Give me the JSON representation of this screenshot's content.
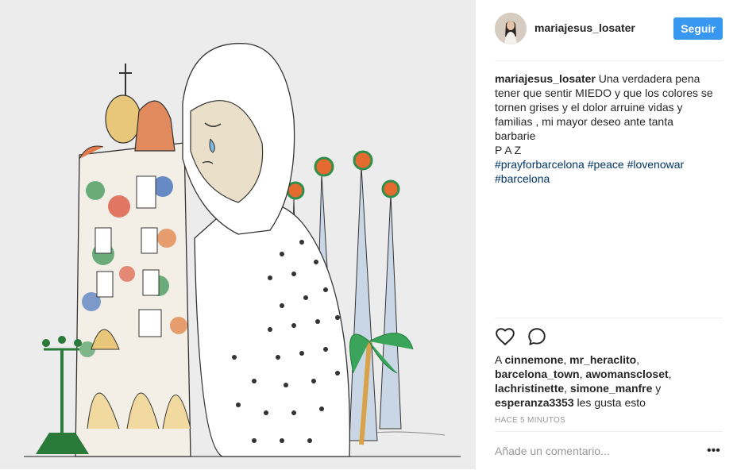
{
  "post": {
    "username": "mariajesus_losater",
    "follow_label": "Seguir",
    "caption": {
      "user": "mariajesus_losater",
      "line1": "Una verdadera pena",
      "line2": "tener que sentir MIEDO y que los colores se",
      "line3": "tornen grises y el dolor arruine vidas y",
      "line4": "familias , mi mayor deseo ante tanta",
      "line5": "barbarie",
      "line6": "P A Z",
      "tags": [
        "#prayforbarcelona",
        "#peace",
        "#lovenowar",
        "#barcelona"
      ]
    },
    "likes": {
      "prefix": "A",
      "names": [
        "cinnemone",
        "mr_heraclito",
        "barcelona_town",
        "awomanscloset",
        "lachristinette",
        "simone_manfre",
        "esperanza3353"
      ],
      "sep1": ",",
      "sep2": ",",
      "sep3": ",",
      "sep4": ",",
      "and": "y",
      "suffix": "les gusta esto"
    },
    "time": "Hace 5 minutos",
    "comment_placeholder": "Añade un comentario...",
    "more_label": "•••"
  },
  "icons": {
    "like": "heart-icon",
    "comment": "comment-icon",
    "more": "more-options-icon"
  },
  "colors": {
    "follow_button": "#3897f0",
    "hashtag": "#003569",
    "image_background": "#ececec"
  }
}
